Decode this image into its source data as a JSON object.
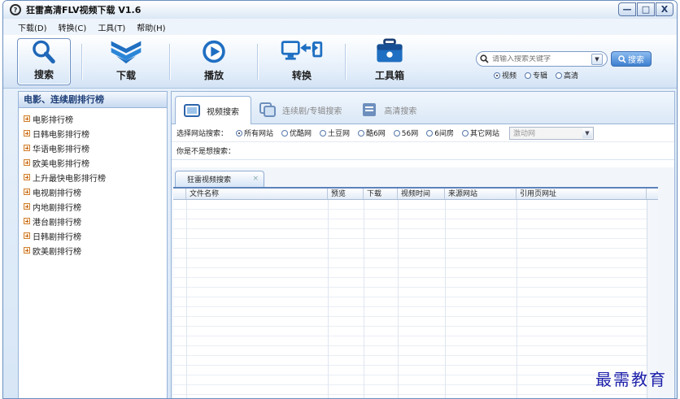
{
  "window": {
    "title": "狂雷高清FLV视频下载 V1.6"
  },
  "window_controls": {
    "minimize": "—",
    "maximize": "□",
    "close": "X"
  },
  "menu": [
    {
      "label": "下载(D)"
    },
    {
      "label": "转换(C)"
    },
    {
      "label": "工具(T)"
    },
    {
      "label": "帮助(H)"
    }
  ],
  "toolbar": {
    "items": [
      {
        "label": "搜索",
        "icon": "search-icon",
        "active": true
      },
      {
        "label": "下载",
        "icon": "download-icon"
      },
      {
        "label": "播放",
        "icon": "play-icon"
      },
      {
        "label": "转换",
        "icon": "convert-icon"
      },
      {
        "label": "工具箱",
        "icon": "toolbox-icon"
      }
    ]
  },
  "search": {
    "placeholder": "请输入搜索关键字",
    "button_label": "搜索",
    "types": [
      {
        "label": "视频",
        "selected": true
      },
      {
        "label": "专辑",
        "selected": false
      },
      {
        "label": "高清",
        "selected": false
      }
    ]
  },
  "sidebar": {
    "title": "电影、连续剧排行榜",
    "items": [
      {
        "label": "电影排行榜"
      },
      {
        "label": "日韩电影排行榜"
      },
      {
        "label": "华语电影排行榜"
      },
      {
        "label": "欧美电影排行榜"
      },
      {
        "label": "上升最快电影排行榜"
      },
      {
        "label": "电视剧排行榜"
      },
      {
        "label": "内地剧排行榜"
      },
      {
        "label": "港台剧排行榜"
      },
      {
        "label": "日韩剧排行榜"
      },
      {
        "label": "欧美剧排行榜"
      }
    ]
  },
  "tabs": [
    {
      "label": "视频搜索",
      "active": true
    },
    {
      "label": "连续剧/专辑搜索",
      "active": false
    },
    {
      "label": "高清搜索",
      "active": false
    }
  ],
  "site_filter": {
    "label": "选择网站搜索：",
    "options": [
      {
        "label": "所有网站",
        "selected": true
      },
      {
        "label": "优酷网",
        "selected": false
      },
      {
        "label": "土豆网",
        "selected": false
      },
      {
        "label": "酷6网",
        "selected": false
      },
      {
        "label": "56网",
        "selected": false
      },
      {
        "label": "6间房",
        "selected": false
      },
      {
        "label": "其它网站",
        "selected": false
      }
    ],
    "dropdown_value": "激动网"
  },
  "suggestion": {
    "label": "你是不是想搜索："
  },
  "results": {
    "tab_label": "狂雷视频搜索",
    "close": "×",
    "columns": [
      "文件名称",
      "预览",
      "下载",
      "视频时间",
      "来源网站",
      "引用页网址"
    ]
  },
  "watermark": "最需教育"
}
